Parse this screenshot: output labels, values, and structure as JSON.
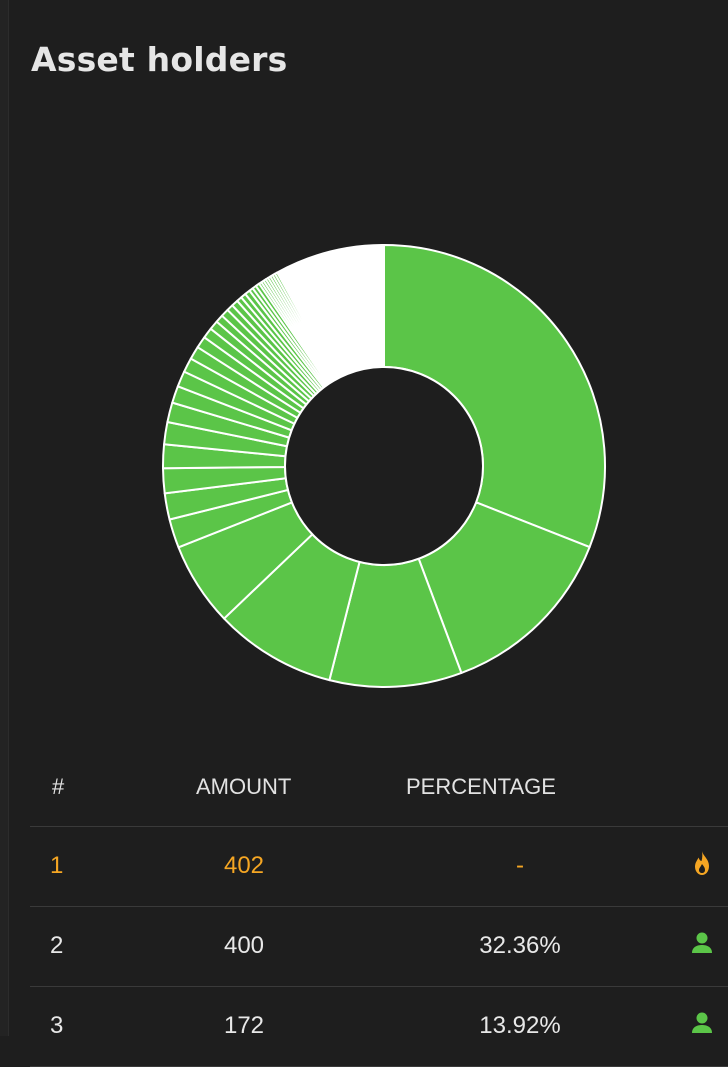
{
  "page": {
    "title": "Asset holders"
  },
  "colors": {
    "background": "#1e1e1e",
    "slice_fill": "#5bc548",
    "slice_stroke": "#ffffff",
    "remainder": "#ffffff",
    "highlight": "#f5a623",
    "holder_icon": "#5bc548"
  },
  "chart_data": {
    "type": "pie",
    "title": "",
    "slice_percentages": [
      32.36,
      13.92,
      10.1,
      9.3,
      6.4,
      2.2,
      2.0,
      1.9,
      1.8,
      1.7,
      1.5,
      1.3,
      1.2,
      1.1,
      1.0,
      0.9,
      0.8,
      0.7,
      0.6,
      0.6,
      0.5,
      0.5,
      0.4,
      0.4,
      0.4,
      0.3,
      0.3,
      0.3,
      0.2,
      0.2,
      0.2,
      0.2,
      0.2,
      0.2,
      0.2,
      0.2
    ],
    "remainder_percentage": 8.38,
    "note": "donut chart; remainder rendered white"
  },
  "table": {
    "headers": {
      "rank": "#",
      "amount": "AMOUNT",
      "percentage": "PERCENTAGE"
    },
    "rows": [
      {
        "rank": "1",
        "amount": "402",
        "percentage": "-",
        "icon": "fire-icon",
        "highlight": true
      },
      {
        "rank": "2",
        "amount": "400",
        "percentage": "32.36%",
        "icon": "user-icon",
        "highlight": false
      },
      {
        "rank": "3",
        "amount": "172",
        "percentage": "13.92%",
        "icon": "user-icon",
        "highlight": false
      }
    ]
  }
}
